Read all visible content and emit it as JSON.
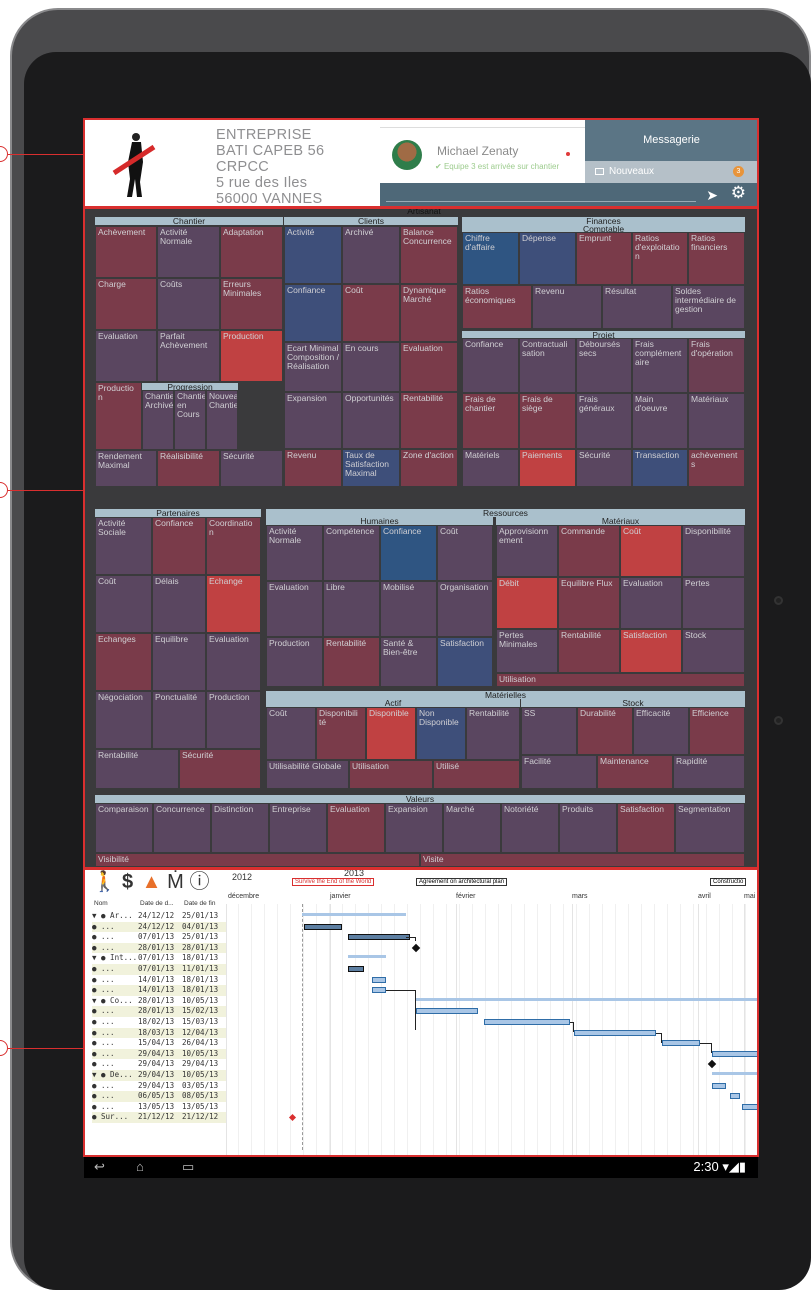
{
  "company": {
    "lines": [
      "ENTREPRISE",
      "BATI CAPEB 56",
      "CRPCC",
      "5 rue des Iles",
      "56000 VANNES"
    ]
  },
  "profile": {
    "name": "Michael Zenaty",
    "status": "Equipe 3 est arrivée sur chantier"
  },
  "messaging": {
    "title": "Messagerie",
    "new_label": "Nouveaux",
    "new_count": "3"
  },
  "treemap": {
    "title": "Artisanat",
    "colors": {
      "red": "#b04042",
      "blue": "#3a5a8a",
      "purple": "#5a4a64"
    },
    "sections": [
      {
        "name": "Chantier"
      },
      {
        "name": "Clients"
      },
      {
        "name": "Finances"
      },
      {
        "name": "Comptable"
      },
      {
        "name": "Projet"
      },
      {
        "name": "Progression"
      },
      {
        "name": "Partenaires"
      },
      {
        "name": "Ressources"
      },
      {
        "name": "Humaines"
      },
      {
        "name": "Matériaux"
      },
      {
        "name": "Matérielles"
      },
      {
        "name": "Actif"
      },
      {
        "name": "Stock"
      },
      {
        "name": "Valeurs"
      }
    ],
    "cells": [
      "Achèvement",
      "Activité Normale",
      "Adaptation",
      "Charge",
      "Coûts",
      "Erreurs Minimales",
      "Evaluation",
      "Parfait Achèvement",
      "Production",
      "Productio n",
      "Chantier Archivé",
      "Chantier en Cours",
      "Nouveau Chantier",
      "Rendement Maximal",
      "Réalisibilité",
      "Sécurité",
      "Activité",
      "Archivé",
      "Balance Concurrence",
      "Confiance",
      "Coût",
      "Dynamique Marché",
      "Ecart Minimal Composition / Réalisation",
      "En cours",
      "Evaluation",
      "Expansion",
      "Opportunités",
      "Rentabilité",
      "Revenu",
      "Taux de Satisfaction Maximal",
      "Zone d'action",
      "Chiffre d'affaire",
      "Dépense",
      "Emprunt",
      "Ratios d'exploitatio n",
      "Ratios financiers",
      "Ratios économiques",
      "Revenu",
      "Résultat",
      "Soldes intermédiaire de gestion",
      "Confiance",
      "Contractuali sation",
      "Déboursés secs",
      "Frais complément aire",
      "Frais d'opération",
      "Frais de chantier",
      "Frais de siège",
      "Frais généraux",
      "Main d'oeuvre",
      "Matériaux",
      "Matériels",
      "Paiements",
      "Sécurité",
      "Transaction",
      "achèvement s",
      "Activité Sociale",
      "Confiance",
      "Coordinatio n",
      "Coût",
      "Délais",
      "Echange",
      "Echanges",
      "Equilibre",
      "Evaluation",
      "Négociation",
      "Ponctualité",
      "Production",
      "Rentabilité",
      "Sécurité",
      "Activité Normale",
      "Compétence",
      "Confiance",
      "Coût",
      "Evaluation",
      "Libre",
      "Mobilisé",
      "Organisation",
      "Production",
      "Rentabilité",
      "Santé & Bien-être",
      "Satisfaction",
      "Approvisionn ement",
      "Commande",
      "Coût",
      "Disponibilité",
      "Débit",
      "Equilibre Flux",
      "Evaluation",
      "Pertes",
      "Pertes Minimales",
      "Rentabilité",
      "Satisfaction",
      "Stock",
      "Utilisation",
      "Coût",
      "Disponibili té",
      "Disponible",
      "Non Disponible",
      "Rentabilité",
      "SS",
      "Durabilité",
      "Efficacité",
      "Efficience",
      "Utilisabilité Globale",
      "Utilisation",
      "Utilisé",
      "Facilité",
      "Maintenance",
      "Rapidité",
      "Comparaison",
      "Concurrence",
      "Distinction",
      "Entreprise",
      "Evaluation",
      "Expansion",
      "Marché",
      "Notoriété",
      "Produits",
      "Satisfaction",
      "Segmentation",
      "Visibilité",
      "Visite"
    ]
  },
  "gantt": {
    "icons": [
      "person-icon",
      "dollar-icon",
      "cone-icon",
      "team-icon",
      "info-icon"
    ],
    "columns": [
      "Nom",
      "Date de d...",
      "Date de fin"
    ],
    "years": [
      "2012",
      "2013"
    ],
    "milestones": [
      "Survive the End of the World",
      "Agreement on architectural plan",
      "Constructio"
    ],
    "months": [
      "décembre",
      "janvier",
      "février",
      "mars",
      "avril",
      "mai"
    ],
    "rows": [
      {
        "name": "▼ ● Ar...",
        "start": "24/12/12",
        "end": "25/01/13"
      },
      {
        "name": "   ● ...",
        "start": "24/12/12",
        "end": "04/01/13"
      },
      {
        "name": "   ● ...",
        "start": "07/01/13",
        "end": "25/01/13"
      },
      {
        "name": "   ● ...",
        "start": "28/01/13",
        "end": "28/01/13"
      },
      {
        "name": "▼ ● Int...",
        "start": "07/01/13",
        "end": "18/01/13"
      },
      {
        "name": "   ● ...",
        "start": "07/01/13",
        "end": "11/01/13"
      },
      {
        "name": "   ● ...",
        "start": "14/01/13",
        "end": "18/01/13"
      },
      {
        "name": "   ● ...",
        "start": "14/01/13",
        "end": "18/01/13"
      },
      {
        "name": "▼ ● Co...",
        "start": "28/01/13",
        "end": "10/05/13"
      },
      {
        "name": "   ● ...",
        "start": "28/01/13",
        "end": "15/02/13"
      },
      {
        "name": "   ● ...",
        "start": "18/02/13",
        "end": "15/03/13"
      },
      {
        "name": "   ● ...",
        "start": "18/03/13",
        "end": "12/04/13"
      },
      {
        "name": "   ● ...",
        "start": "15/04/13",
        "end": "26/04/13"
      },
      {
        "name": "   ● ...",
        "start": "29/04/13",
        "end": "10/05/13"
      },
      {
        "name": "   ● ...",
        "start": "29/04/13",
        "end": "29/04/13"
      },
      {
        "name": "▼ ● De...",
        "start": "29/04/13",
        "end": "10/05/13"
      },
      {
        "name": "   ● ...",
        "start": "29/04/13",
        "end": "03/05/13"
      },
      {
        "name": "   ● ...",
        "start": "06/05/13",
        "end": "08/05/13"
      },
      {
        "name": "   ● ...",
        "start": "13/05/13",
        "end": "13/05/13"
      },
      {
        "name": "● Sur...",
        "start": "21/12/12",
        "end": "21/12/12"
      }
    ]
  },
  "statusbar": {
    "time": "2:30"
  }
}
